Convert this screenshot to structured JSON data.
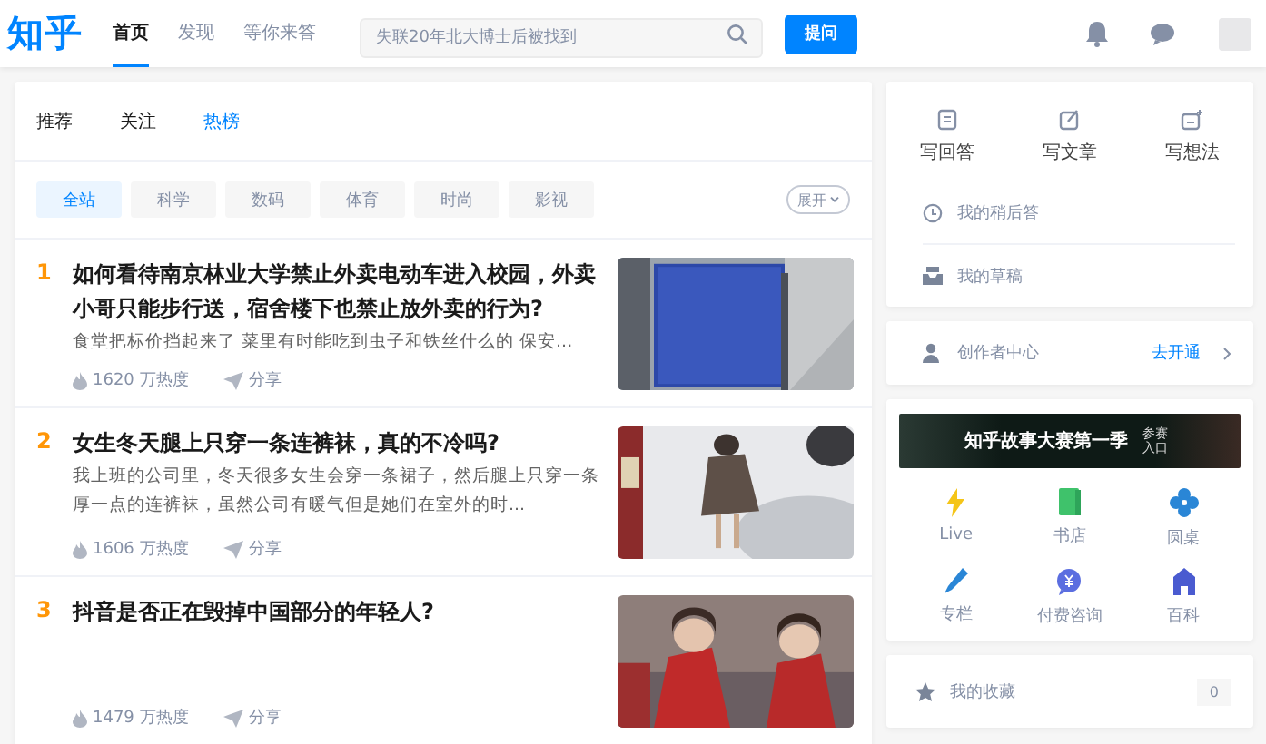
{
  "header": {
    "logo": "知乎",
    "nav": [
      {
        "label": "首页",
        "selected": true
      },
      {
        "label": "发现",
        "selected": false
      },
      {
        "label": "等你来答",
        "selected": false
      }
    ],
    "search": {
      "placeholder": "失联20年北大博士后被找到"
    },
    "ask_button": "提问"
  },
  "feed_tabs": [
    {
      "label": "推荐",
      "selected": false
    },
    {
      "label": "关注",
      "selected": false
    },
    {
      "label": "热榜",
      "selected": true
    }
  ],
  "filters": [
    {
      "label": "全站",
      "selected": true
    },
    {
      "label": "科学",
      "selected": false
    },
    {
      "label": "数码",
      "selected": false
    },
    {
      "label": "体育",
      "selected": false
    },
    {
      "label": "时尚",
      "selected": false
    },
    {
      "label": "影视",
      "selected": false
    }
  ],
  "expand_button": "展开",
  "hot_list": [
    {
      "rank": "1",
      "title": "如何看待南京林业大学禁止外卖电动车进入校园，外卖小哥只能步行送，宿舍楼下也禁止放外卖的行为?",
      "excerpt": "食堂把标价挡起来了 菜里有时能吃到虫子和铁丝什么的 保安...",
      "heat": "1620 万热度",
      "share": "分享"
    },
    {
      "rank": "2",
      "title": "女生冬天腿上只穿一条连裤袜，真的不冷吗?",
      "excerpt": "我上班的公司里，冬天很多女生会穿一条裙子，然后腿上只穿一条厚一点的连裤袜，虽然公司有暖气但是她们在室外的时...",
      "heat": "1606 万热度",
      "share": "分享"
    },
    {
      "rank": "3",
      "title": "抖音是否正在毁掉中国部分的年轻人?",
      "heat": "1479 万热度",
      "share": "分享"
    }
  ],
  "write_actions": [
    {
      "kind": "answer",
      "label": "写回答"
    },
    {
      "kind": "article",
      "label": "写文章"
    },
    {
      "kind": "idea",
      "label": "写想法"
    }
  ],
  "my_links": [
    {
      "kind": "later",
      "label": "我的稍后答"
    },
    {
      "kind": "draft",
      "label": "我的草稿"
    }
  ],
  "creator": {
    "label": "创作者中心",
    "action": "去开通"
  },
  "banner": {
    "title": "知乎故事大赛第一季",
    "entry": "参赛入口"
  },
  "services": [
    {
      "kind": "live",
      "label": "Live"
    },
    {
      "kind": "book",
      "label": "书店"
    },
    {
      "kind": "round",
      "label": "圆桌"
    },
    {
      "kind": "column",
      "label": "专栏"
    },
    {
      "kind": "consult",
      "label": "付费咨询"
    },
    {
      "kind": "wiki",
      "label": "百科"
    }
  ],
  "favorites": {
    "label": "我的收藏",
    "count": "0"
  }
}
